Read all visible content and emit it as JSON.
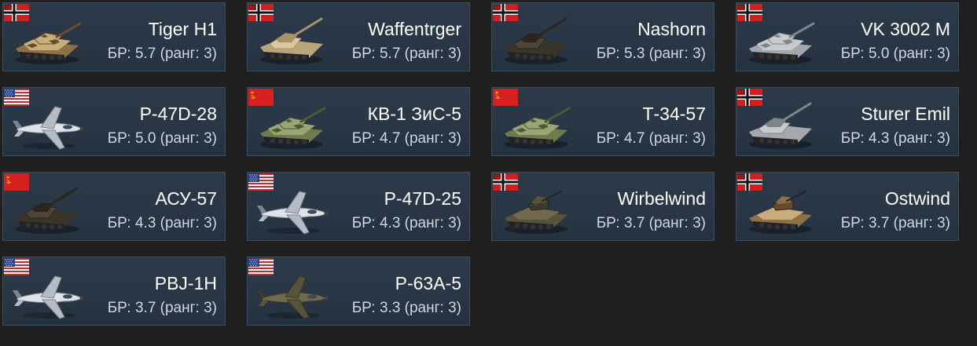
{
  "colors": {
    "page_background": "#1f1f1f",
    "card_background": "#283645",
    "card_border": "#3a4d5f",
    "name_text": "#ffffff",
    "br_text": "#cfd7de"
  },
  "vehicles": [
    {
      "name": "Tiger H1",
      "br": "БР: 5.7 (ранг: 3)",
      "nation": "germany",
      "kind": "tank",
      "camo": "desert"
    },
    {
      "name": "Waffentrger",
      "br": "БР: 5.7 (ранг: 3)",
      "nation": "germany",
      "kind": "spg",
      "camo": "sand"
    },
    {
      "name": "Nashorn",
      "br": "БР: 5.3 (ранг: 3)",
      "nation": "germany",
      "kind": "spg",
      "camo": "dark"
    },
    {
      "name": "VK 3002 M",
      "br": "БР: 5.0 (ранг: 3)",
      "nation": "germany",
      "kind": "tank",
      "camo": "grey"
    },
    {
      "name": "P-47D-28",
      "br": "БР: 5.0 (ранг: 3)",
      "nation": "usa",
      "kind": "plane",
      "camo": "silver"
    },
    {
      "name": "КВ-1 ЗиС-5",
      "br": "БР: 4.7 (ранг: 3)",
      "nation": "ussr",
      "kind": "tank",
      "camo": "green"
    },
    {
      "name": "Т-34-57",
      "br": "БР: 4.7 (ранг: 3)",
      "nation": "ussr",
      "kind": "tank",
      "camo": "green"
    },
    {
      "name": "Sturer Emil",
      "br": "БР: 4.3 (ранг: 3)",
      "nation": "germany",
      "kind": "spg",
      "camo": "grey"
    },
    {
      "name": "АСУ-57",
      "br": "БР: 4.3 (ранг: 3)",
      "nation": "ussr",
      "kind": "spg",
      "camo": "dark"
    },
    {
      "name": "P-47D-25",
      "br": "БР: 4.3 (ранг: 3)",
      "nation": "usa",
      "kind": "plane",
      "camo": "silver"
    },
    {
      "name": "Wirbelwind",
      "br": "БР: 3.7 (ранг: 3)",
      "nation": "germany",
      "kind": "aa",
      "camo": "olive"
    },
    {
      "name": "Ostwind",
      "br": "БР: 3.7 (ранг: 3)",
      "nation": "germany",
      "kind": "aa",
      "camo": "desert"
    },
    {
      "name": "PBJ-1H",
      "br": "БР: 3.7 (ранг: 3)",
      "nation": "usa",
      "kind": "plane",
      "camo": "silver"
    },
    {
      "name": "P-63A-5",
      "br": "БР: 3.3 (ранг: 3)",
      "nation": "usa",
      "kind": "plane",
      "camo": "olive"
    }
  ]
}
